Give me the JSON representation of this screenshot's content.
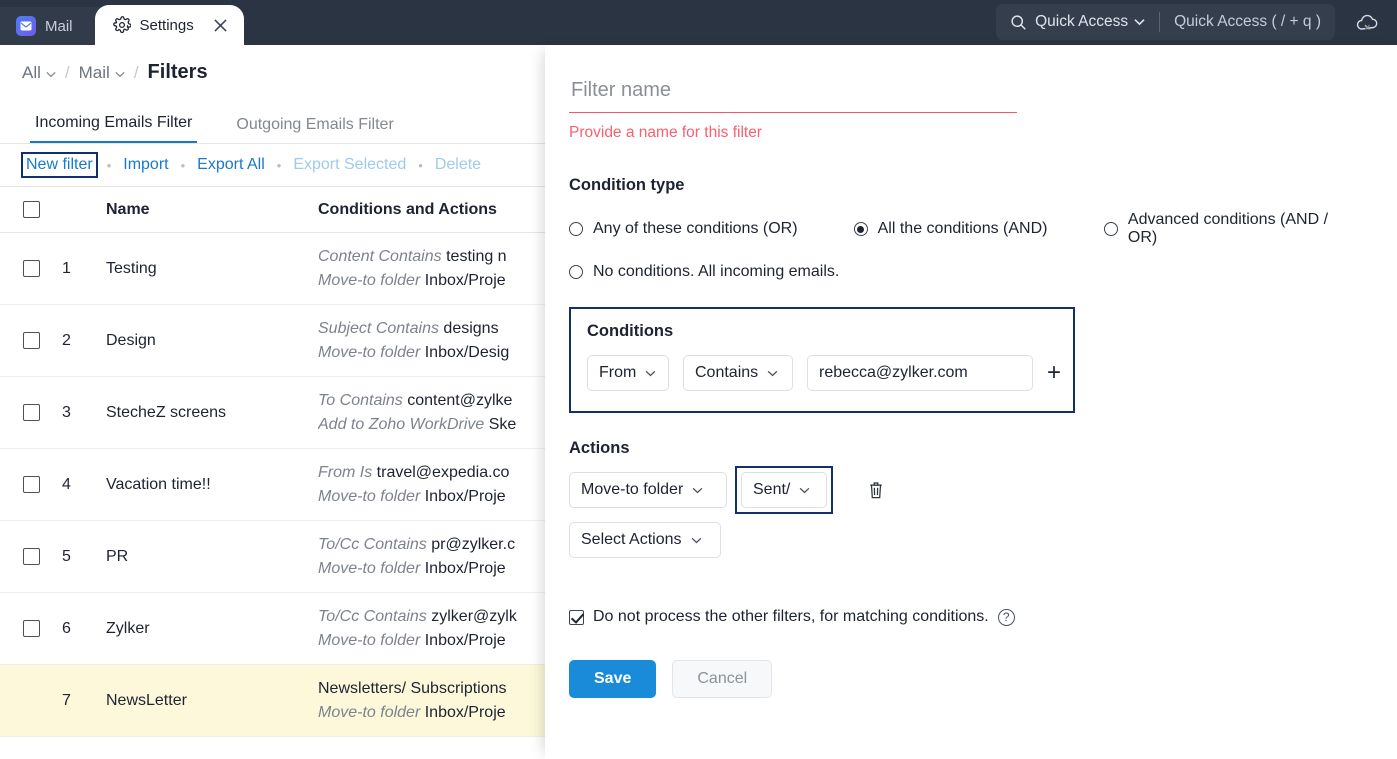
{
  "browser": {
    "tabs": [
      {
        "label": "Mail",
        "icon": "mail-app-icon",
        "active": false
      },
      {
        "label": "Settings",
        "icon": "gear-icon",
        "active": true,
        "close_icon": "close-icon"
      }
    ],
    "quick_access": {
      "search_icon": "search-icon",
      "label": "Quick Access",
      "caret_icon": "chevron-down-icon",
      "hint": "Quick Access  ( / + q )"
    },
    "cloud_icon": "cloud-off-icon"
  },
  "breadcrumb": {
    "items": [
      {
        "label": "All",
        "caret": true
      },
      {
        "label": "Mail",
        "caret": true
      }
    ],
    "separator": "/",
    "current": "Filters"
  },
  "filter_tabs": [
    {
      "label": "Incoming Emails Filter",
      "active": true
    },
    {
      "label": "Outgoing Emails Filter",
      "active": false
    }
  ],
  "toolbar": {
    "separator": "•",
    "items": [
      {
        "label": "New filter",
        "disabled": false,
        "focused": true
      },
      {
        "label": "Import",
        "disabled": false,
        "focused": false
      },
      {
        "label": "Export All",
        "disabled": false,
        "focused": false
      },
      {
        "label": "Export Selected",
        "disabled": true,
        "focused": false
      },
      {
        "label": "Delete",
        "disabled": true,
        "focused": false
      }
    ]
  },
  "table": {
    "headers": {
      "name": "Name",
      "conditions": "Conditions and Actions"
    },
    "rows": [
      {
        "num": "1",
        "name": "Testing",
        "checkbox": true,
        "highlight": false,
        "line1_key": "Content Contains",
        "line1_val": "testing n",
        "line2_key": "Move-to folder",
        "line2_val": "Inbox/Proje"
      },
      {
        "num": "2",
        "name": "Design",
        "checkbox": true,
        "highlight": false,
        "line1_key": "Subject Contains",
        "line1_val": "designs",
        "line2_key": "Move-to folder",
        "line2_val": "Inbox/Desig"
      },
      {
        "num": "3",
        "name": "StecheZ screens",
        "checkbox": true,
        "highlight": false,
        "line1_key": "To Contains",
        "line1_val": "content@zylke",
        "line2_key": "Add to Zoho WorkDrive",
        "line2_val": "Ske"
      },
      {
        "num": "4",
        "name": "Vacation time!!",
        "checkbox": true,
        "highlight": false,
        "line1_key": "From Is",
        "line1_val": "travel@expedia.co",
        "line2_key": "Move-to folder",
        "line2_val": "Inbox/Proje"
      },
      {
        "num": "5",
        "name": "PR",
        "checkbox": true,
        "highlight": false,
        "line1_key": "To/Cc Contains",
        "line1_val": "pr@zylker.c",
        "line2_key": "Move-to folder",
        "line2_val": "Inbox/Proje"
      },
      {
        "num": "6",
        "name": "Zylker",
        "checkbox": true,
        "highlight": false,
        "line1_key": "To/Cc Contains",
        "line1_val": "zylker@zylk",
        "line2_key": "Move-to folder",
        "line2_val": "Inbox/Proje"
      },
      {
        "num": "7",
        "name": "NewsLetter",
        "checkbox": false,
        "highlight": true,
        "line1_key": "",
        "line1_val": "Newsletters/ Subscriptions",
        "line2_key": "Move-to folder",
        "line2_val": "Inbox/Proje"
      }
    ]
  },
  "panel": {
    "filter_name": {
      "value": "",
      "placeholder": "Filter name",
      "error": "Provide a name for this filter"
    },
    "condition_type": {
      "title": "Condition type",
      "options": [
        {
          "label": "Any of these conditions (OR)",
          "selected": false
        },
        {
          "label": "All the conditions (AND)",
          "selected": true
        },
        {
          "label": "Advanced conditions (AND / OR)",
          "selected": false
        },
        {
          "label": "No conditions. All incoming emails.",
          "selected": false
        }
      ]
    },
    "conditions": {
      "title": "Conditions",
      "field_select": "From",
      "operator_select": "Contains",
      "value_input": "rebecca@zylker.com",
      "add_icon": "+",
      "caret_icon": "chevron-down-icon"
    },
    "actions": {
      "title": "Actions",
      "action_select": "Move-to folder",
      "target_select": "Sent/",
      "delete_icon": "trash-icon",
      "add_action_select": "Select Actions",
      "caret_icon": "chevron-down-icon"
    },
    "stop_processing": {
      "label": "Do not process the other filters, for matching conditions.",
      "checked": true,
      "help_icon": "help-icon",
      "help_glyph": "?"
    },
    "buttons": {
      "save": "Save",
      "cancel": "Cancel"
    }
  },
  "colors": {
    "topbar": "#2b3443",
    "accent_blue": "#1a79c9",
    "focus_outline": "#12306e",
    "error_red": "#f4616f",
    "save_blue": "#1a8bd8",
    "row_highlight": "#fdf8da"
  }
}
